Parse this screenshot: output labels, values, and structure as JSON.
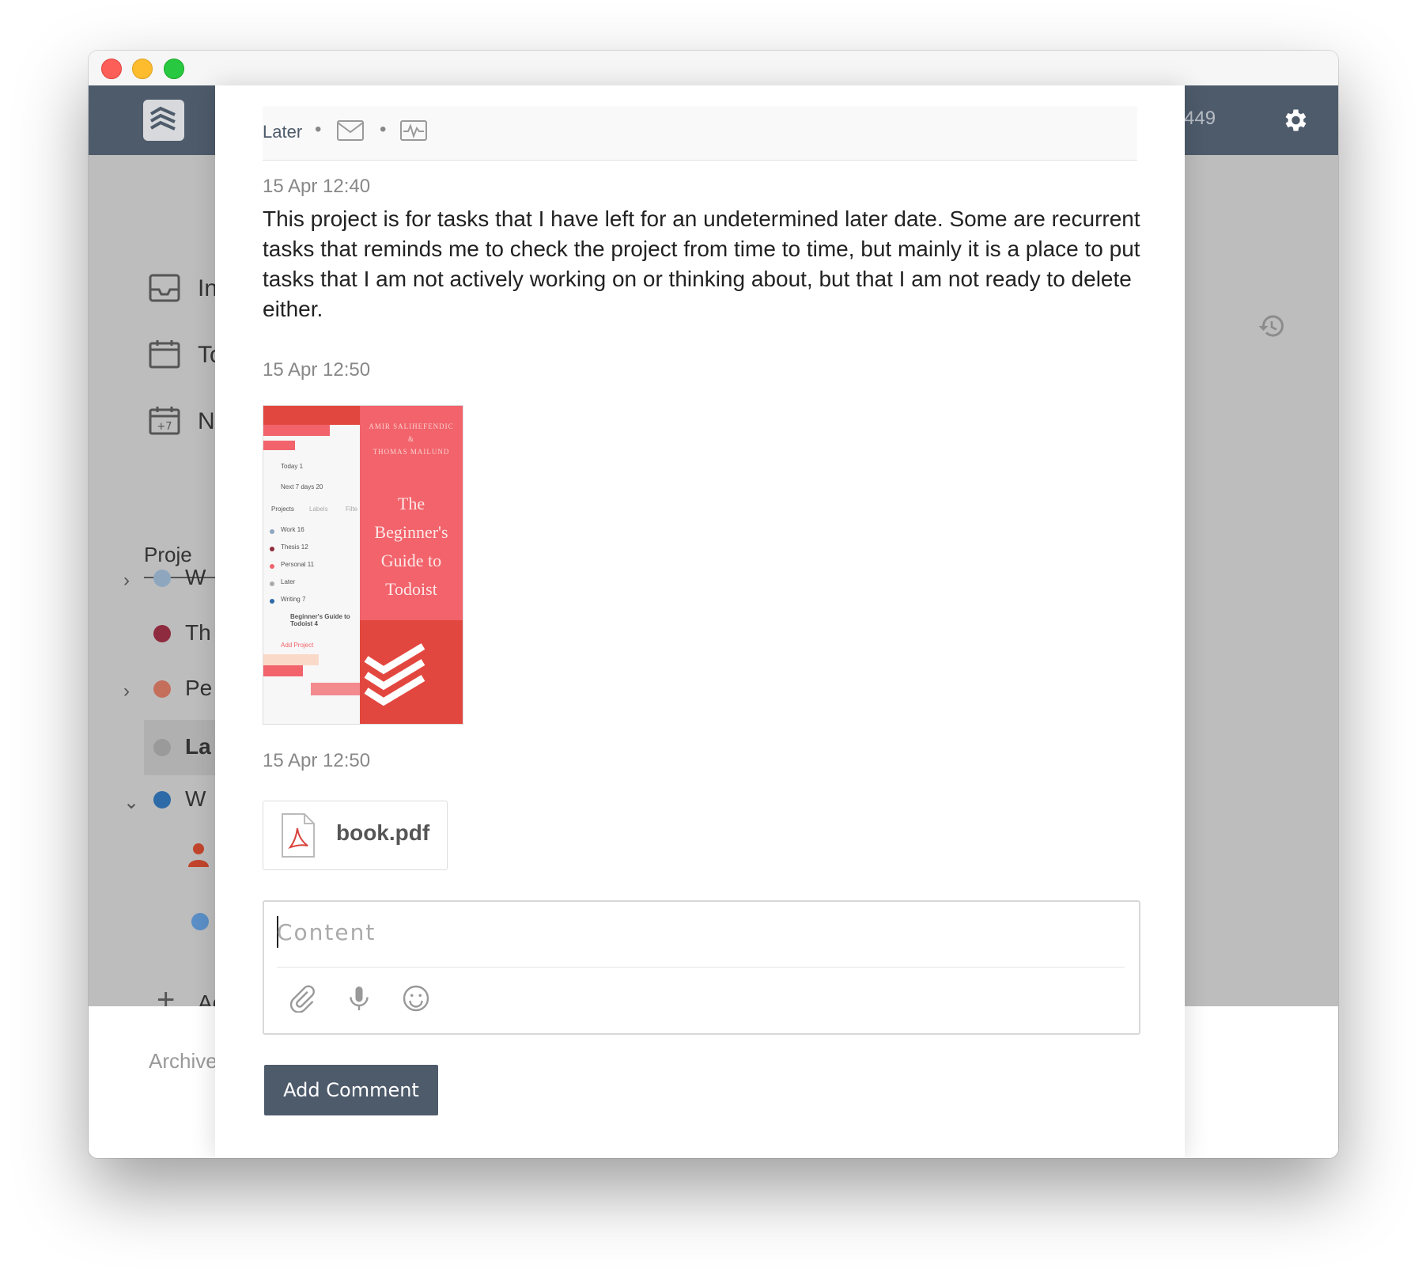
{
  "window": {
    "title": ""
  },
  "topbar": {
    "counter": "449"
  },
  "sidebar": {
    "nav": [
      {
        "label": "In",
        "icon": "inbox-icon"
      },
      {
        "label": "To",
        "icon": "calendar-today-icon"
      },
      {
        "label": "Ne",
        "icon": "calendar-next7-icon"
      }
    ],
    "next7_badge": "+7",
    "tab_projects": "Proje",
    "projects": [
      {
        "label": "W",
        "color": "#8ea7bf",
        "chevron": "›"
      },
      {
        "label": "Th",
        "color": "#8e2b3e",
        "chevron": ""
      },
      {
        "label": "Pe",
        "color": "#c46f5c",
        "chevron": "›"
      },
      {
        "label": "La",
        "color": "#9a9a9a",
        "chevron": ""
      },
      {
        "label": "W",
        "color": "#2d6aa8",
        "chevron": "⌄"
      }
    ],
    "add_label": "Ad",
    "add_icon": "+",
    "archive": "Archive"
  },
  "modal": {
    "project_name": "Later",
    "separator": "•",
    "comments": [
      {
        "timestamp": "15 Apr 12:40",
        "text": "This project is for tasks that I have left for an undetermined later date. Some are recurrent tasks that reminds me to check the project from time to time, but mainly it is a place to put tasks that I am not actively working on or thinking about, but that I am not ready to delete either."
      },
      {
        "timestamp": "15 Apr 12:50",
        "attachment": "image"
      },
      {
        "timestamp": "15 Apr 12:50",
        "file": "book.pdf"
      }
    ],
    "thumbnail": {
      "authors_line1": "AMIR SALIHEFENDIC",
      "authors_line2": "&",
      "authors_line3": "THOMAS MAILUND",
      "title_line1": "The",
      "title_line2": "Beginner's",
      "title_line3": "Guide to",
      "title_line4": "Todoist",
      "mini_items": [
        "Today 1",
        "Next 7 days 20",
        "Projects",
        "Labels",
        "Filte",
        "Work 16",
        "Thesis 12",
        "Personal 11",
        "Later",
        "Writing 7",
        "Beginner's Guide to Todoist 4",
        "Add Project"
      ]
    },
    "composer": {
      "placeholder": "Content",
      "value": "",
      "submit_label": "Add Comment"
    }
  },
  "colors": {
    "accent": "#4e5b6b",
    "pdf_red": "#d9423b",
    "book_red": "#f2636b"
  }
}
